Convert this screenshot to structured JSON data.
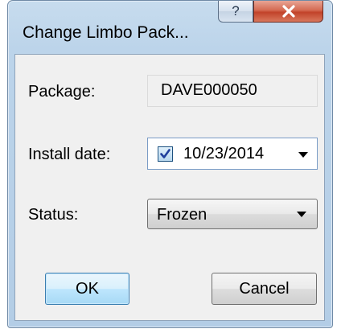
{
  "window": {
    "title": "Change Limbo Pack...",
    "help_glyph": "?",
    "close_icon": "close-x-icon"
  },
  "form": {
    "package": {
      "label": "Package:",
      "value": "DAVE000050"
    },
    "install_date": {
      "label": "Install date:",
      "checked": true,
      "value": "10/23/2014"
    },
    "status": {
      "label": "Status:",
      "value": "Frozen"
    }
  },
  "buttons": {
    "ok_label": "OK",
    "cancel_label": "Cancel"
  },
  "colors": {
    "frame": "#bcd4ea",
    "close_button": "#c2432a",
    "client_background": "#f0f0f0",
    "default_button": "#bee6fd"
  }
}
